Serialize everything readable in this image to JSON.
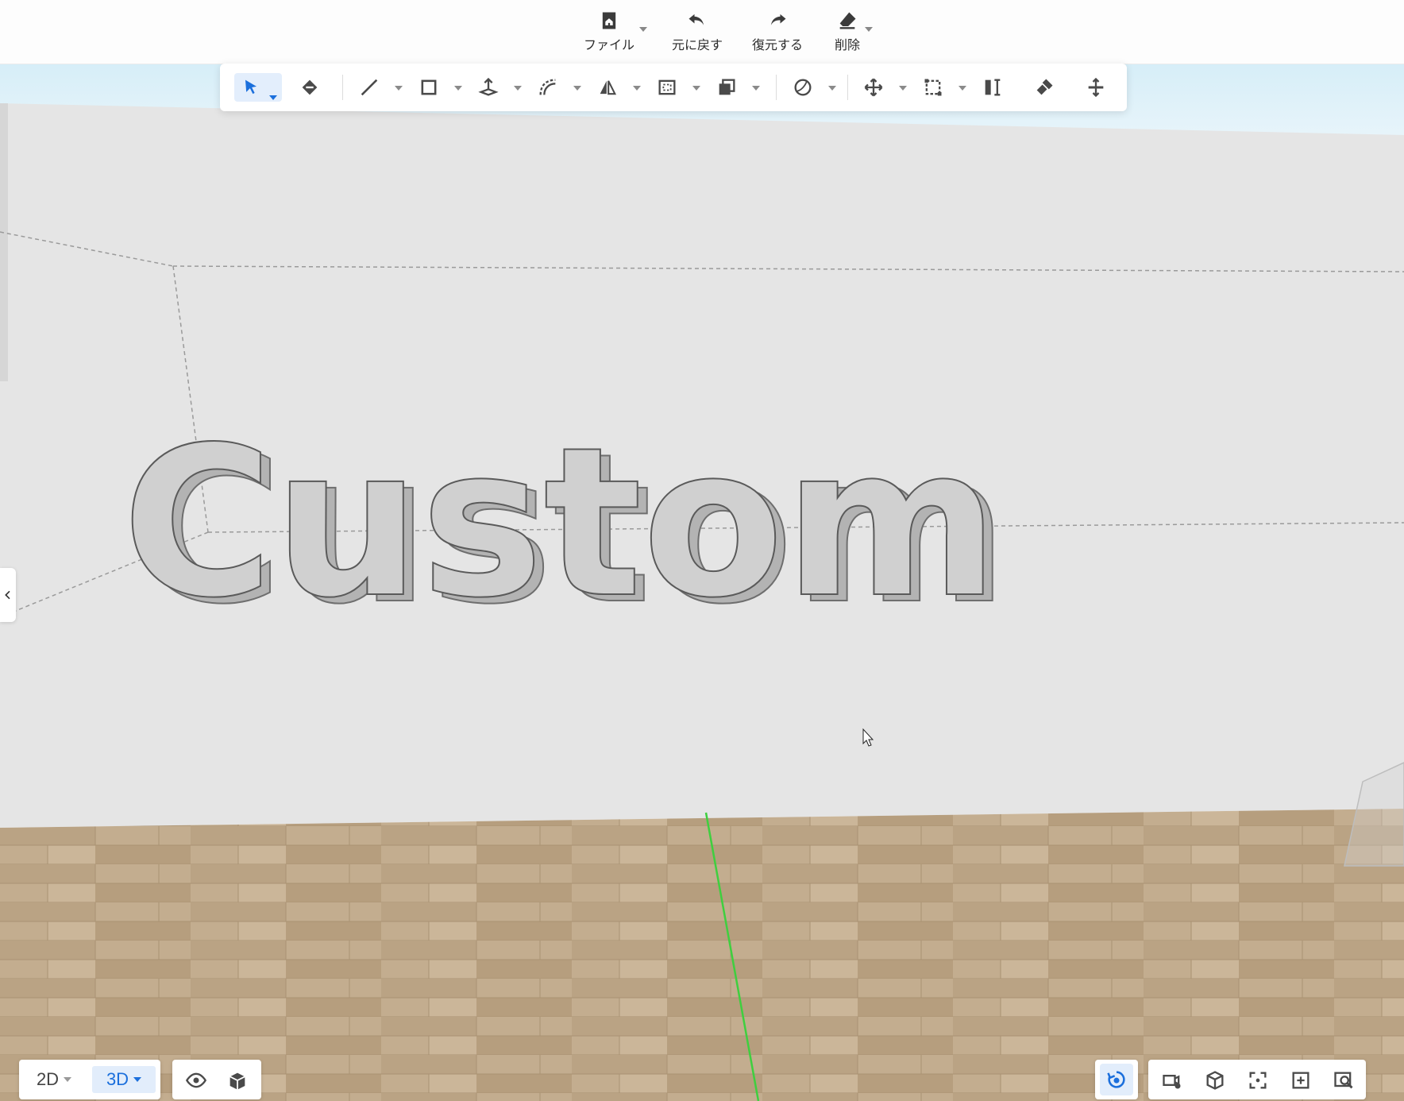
{
  "top_commands": [
    {
      "key": "file",
      "label": "ファイル",
      "icon": "home-file-icon",
      "has_menu": true
    },
    {
      "key": "undo",
      "label": "元に戻す",
      "icon": "undo-arrow-icon",
      "has_menu": false
    },
    {
      "key": "redo",
      "label": "復元する",
      "icon": "redo-arrow-icon",
      "has_menu": false
    },
    {
      "key": "delete",
      "label": "削除",
      "icon": "eraser-icon",
      "has_menu": true
    }
  ],
  "toolbar": {
    "tools": [
      {
        "name": "select-tool",
        "icon": "select-arrow-icon",
        "active": true,
        "has_menu": true
      },
      {
        "name": "paint-bucket-tool",
        "icon": "paint-bucket-icon",
        "active": false,
        "has_menu": false
      },
      {
        "name": "line-tool",
        "icon": "line-icon",
        "active": false,
        "has_menu": true
      },
      {
        "name": "rectangle-tool",
        "icon": "rectangle-icon",
        "active": false,
        "has_menu": true
      },
      {
        "name": "push-pull-tool",
        "icon": "push-pull-icon",
        "active": false,
        "has_menu": true
      },
      {
        "name": "arc-tool",
        "icon": "arc-icon",
        "active": false,
        "has_menu": true
      },
      {
        "name": "mirror-tool",
        "icon": "mirror-icon",
        "active": false,
        "has_menu": true
      },
      {
        "name": "offset-tool",
        "icon": "offset-icon",
        "active": false,
        "has_menu": true
      },
      {
        "name": "copy-tool",
        "icon": "copy-icon",
        "active": false,
        "has_menu": true
      },
      {
        "name": "shape-tool",
        "icon": "shape-sphere-icon",
        "active": false,
        "has_menu": true
      },
      {
        "name": "move-tool",
        "icon": "move-icon",
        "active": false,
        "has_menu": true
      },
      {
        "name": "scale-tool",
        "icon": "scale-icon",
        "active": false,
        "has_menu": true
      },
      {
        "name": "align-tool",
        "icon": "align-icon",
        "active": false,
        "has_menu": false
      },
      {
        "name": "sweep-tool",
        "icon": "sweep-brush-icon",
        "active": false,
        "has_menu": false
      },
      {
        "name": "distribute-tool",
        "icon": "distribute-icon",
        "active": false,
        "has_menu": false
      }
    ]
  },
  "scene": {
    "text": "Custom",
    "wall_color": "#e4e4e4",
    "floor_color": "#c2ab8c",
    "axis_color": "#3fcf3f"
  },
  "view_modes": {
    "mode_2d": "2D",
    "mode_3d": "3D",
    "active": "3D"
  },
  "bottom_left_icons": [
    "eye-visibility-icon",
    "box-view-icon"
  ],
  "bottom_right": {
    "orbit_icon": "orbit-rotate-icon",
    "orbit_active": true,
    "icons": [
      "camera-settings-icon",
      "cube-view-icon",
      "focus-frame-icon",
      "zoom-area-icon",
      "zoom-search-icon"
    ]
  },
  "colors": {
    "accent": "#1b6fdc",
    "accent_bg": "#e2edfb",
    "icon": "#4a4a4a"
  }
}
